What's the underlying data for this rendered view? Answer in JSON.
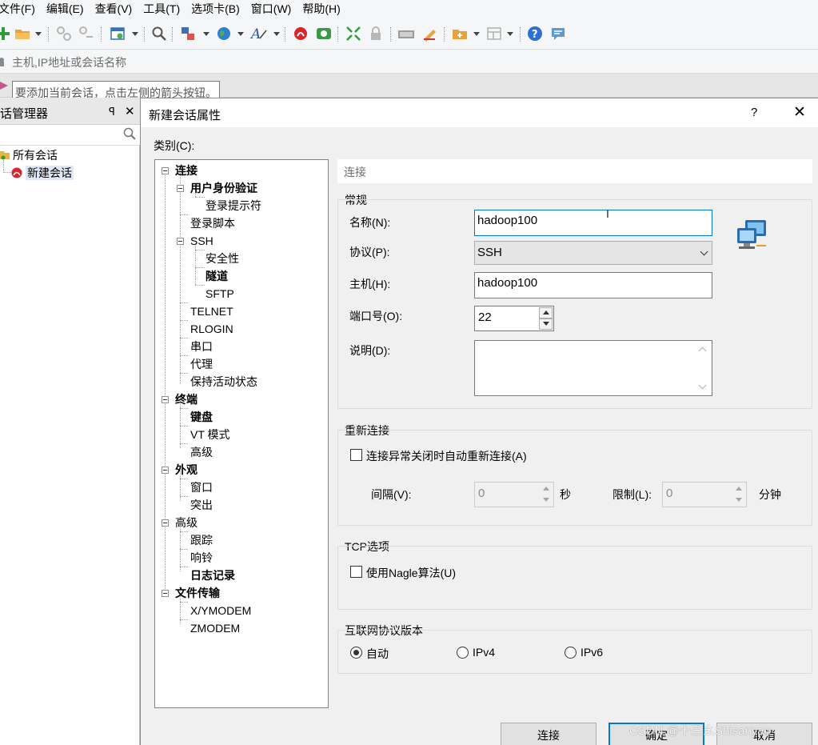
{
  "menubar": {
    "items": [
      "文件(F)",
      "编辑(E)",
      "查看(V)",
      "工具(T)",
      "选项卡(B)",
      "窗口(W)",
      "帮助(H)"
    ]
  },
  "toolbar": {
    "icons": [
      "new-session-icon",
      "open-folder-icon",
      "connect-icon",
      "disconnect-icon",
      "properties-icon",
      "find-icon",
      "transfer-icon",
      "globe-icon",
      "font-icon",
      "xshell-icon",
      "xftp-icon",
      "fullscreen-icon",
      "lock-icon",
      "keyboard-icon",
      "highlight-icon",
      "new-tab-icon",
      "layout-icon",
      "help-icon",
      "chat-icon"
    ]
  },
  "address": {
    "placeholder": "主机,IP地址或会话名称"
  },
  "hint": {
    "text": "要添加当前会话，点击左侧的箭头按钮。"
  },
  "session_manager": {
    "title": "话管理器",
    "pin": "ꟼ",
    "close": "✕",
    "tree": [
      {
        "label": "所有会话"
      },
      {
        "label": "新建会话"
      }
    ]
  },
  "dialog": {
    "title": "新建会话属性",
    "help": "?",
    "close": "✕",
    "category_label": "类别(C):",
    "category_tree": [
      {
        "label": "连接"
      },
      {
        "label": "用户身份验证"
      },
      {
        "label": "登录提示符"
      },
      {
        "label": "登录脚本"
      },
      {
        "label": "SSH"
      },
      {
        "label": "安全性"
      },
      {
        "label": "隧道"
      },
      {
        "label": "SFTP"
      },
      {
        "label": "TELNET"
      },
      {
        "label": "RLOGIN"
      },
      {
        "label": "串口"
      },
      {
        "label": "代理"
      },
      {
        "label": "保持活动状态"
      },
      {
        "label": "终端"
      },
      {
        "label": "键盘"
      },
      {
        "label": "VT 模式"
      },
      {
        "label": "高级"
      },
      {
        "label": "外观"
      },
      {
        "label": "窗口"
      },
      {
        "label": "突出"
      },
      {
        "label": "高级"
      },
      {
        "label": "跟踪"
      },
      {
        "label": "响铃"
      },
      {
        "label": "日志记录"
      },
      {
        "label": "文件传输"
      },
      {
        "label": "X/YMODEM"
      },
      {
        "label": "ZMODEM"
      }
    ],
    "section_header": "连接",
    "general": {
      "title": "常规",
      "name_label": "名称(N):",
      "name_value": "hadoop100",
      "protocol_label": "协议(P):",
      "protocol_value": "SSH",
      "host_label": "主机(H):",
      "host_value": "hadoop100",
      "port_label": "端口号(O):",
      "port_value": "22",
      "desc_label": "说明(D):",
      "desc_value": ""
    },
    "reconnect": {
      "title": "重新连接",
      "auto_label": "连接异常关闭时自动重新连接(A)",
      "auto_checked": false,
      "interval_label": "间隔(V):",
      "interval_value": "0",
      "interval_unit": "秒",
      "limit_label": "限制(L):",
      "limit_value": "0",
      "limit_unit": "分钟"
    },
    "tcp": {
      "title": "TCP选项",
      "nagle_label": "使用Nagle算法(U)",
      "nagle_checked": false
    },
    "ipver": {
      "title": "互联网协议版本",
      "options": [
        "自动",
        "IPv4",
        "IPv6"
      ],
      "selected": "自动"
    },
    "buttons": {
      "connect": "连接",
      "ok": "确定",
      "cancel": "取消"
    }
  },
  "watermark": "CSDN @十三幺Shisanyao",
  "colors": {
    "accent": "#0078d7",
    "panel": "#f0f0f0"
  }
}
